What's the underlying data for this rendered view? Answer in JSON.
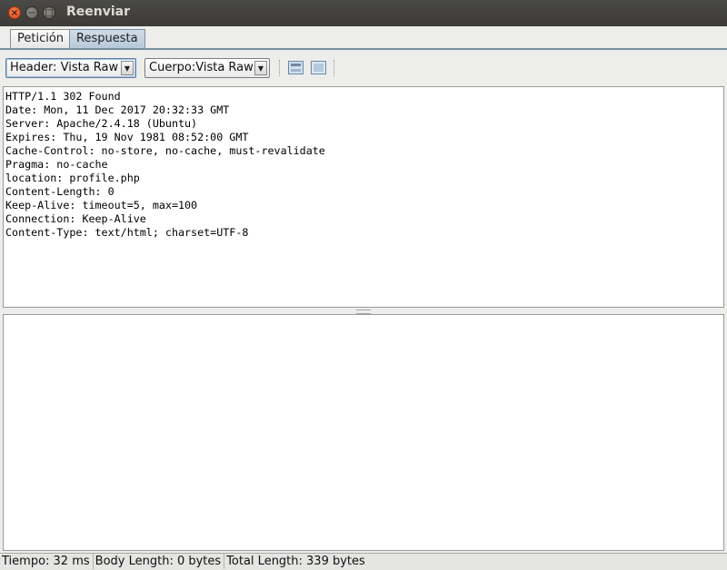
{
  "window": {
    "title": "Reenviar",
    "close_glyph": "×",
    "minimize_glyph": "−",
    "maximize_glyph": "□"
  },
  "tabs": [
    {
      "label": "Petición",
      "selected": false
    },
    {
      "label": "Respuesta",
      "selected": true
    }
  ],
  "toolbar": {
    "header_view": "Header: Vista Raw",
    "body_view": "Cuerpo:Vista Raw",
    "dropdown_arrow": "▼"
  },
  "response": {
    "headers_text": "HTTP/1.1 302 Found\nDate: Mon, 11 Dec 2017 20:32:33 GMT\nServer: Apache/2.4.18 (Ubuntu)\nExpires: Thu, 19 Nov 1981 08:52:00 GMT\nCache-Control: no-store, no-cache, must-revalidate\nPragma: no-cache\nlocation: profile.php\nContent-Length: 0\nKeep-Alive: timeout=5, max=100\nConnection: Keep-Alive\nContent-Type: text/html; charset=UTF-8",
    "body_text": ""
  },
  "status": {
    "time": "Tiempo: 32 ms",
    "body_length": "Body Length: 0 bytes",
    "total_length": "Total Length: 339 bytes"
  },
  "colors": {
    "titlebar": "#3c3b37",
    "close_button": "#df4a16",
    "selected_tab": "#b7c9d9",
    "background": "#ededec"
  }
}
